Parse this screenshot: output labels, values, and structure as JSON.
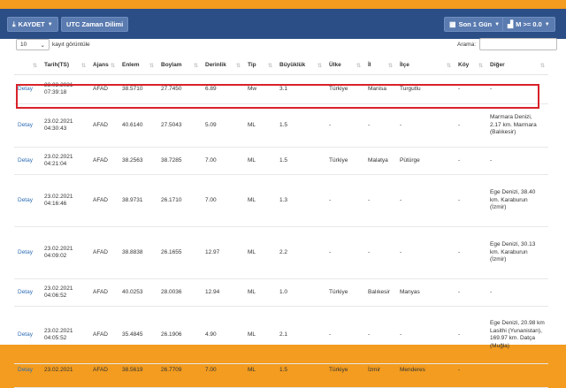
{
  "toolbar": {
    "save_label": "KAYDET",
    "utc_label": "UTC Zaman Dilimi",
    "period_label": "Son 1 Gün",
    "magnitude_label": "M >= 0.0"
  },
  "controls": {
    "page_length": "10",
    "page_length_suffix": "kayıt görüntüle",
    "search_label": "Arama:"
  },
  "table": {
    "headers": [
      "",
      "Tarih(TS)",
      "Ajans",
      "Enlem",
      "Boylam",
      "Derinlik",
      "Tip",
      "Büyüklük",
      "Ülke",
      "İl",
      "İlçe",
      "Köy",
      "Diğer"
    ],
    "rows": [
      {
        "detail": "Detay",
        "date": "23.02.2021",
        "time": "07:39:18",
        "agency": "AFAD",
        "lat": "38.5710",
        "lon": "27.7450",
        "depth": "6.89",
        "type": "Mw",
        "mag": "3.1",
        "country": "Türkiye",
        "province": "Manisa",
        "district": "Turgutlu",
        "village": "-",
        "other": "-"
      },
      {
        "detail": "Detay",
        "date": "23.02.2021",
        "time": "04:30:43",
        "agency": "AFAD",
        "lat": "40.6140",
        "lon": "27.5043",
        "depth": "5.09",
        "type": "ML",
        "mag": "1.5",
        "country": "-",
        "province": "-",
        "district": "-",
        "village": "-",
        "other": "Marmara Denizi, 2.17 km. Marmara (Balıkesir)"
      },
      {
        "detail": "Detay",
        "date": "23.02.2021",
        "time": "04:21:04",
        "agency": "AFAD",
        "lat": "38.2563",
        "lon": "38.7285",
        "depth": "7.00",
        "type": "ML",
        "mag": "1.5",
        "country": "Türkiye",
        "province": "Malatya",
        "district": "Pütürge",
        "village": "-",
        "other": "-"
      },
      {
        "detail": "Detay",
        "date": "23.02.2021",
        "time": "04:16:46",
        "agency": "AFAD",
        "lat": "38.9731",
        "lon": "26.1710",
        "depth": "7.00",
        "type": "ML",
        "mag": "1.3",
        "country": "-",
        "province": "-",
        "district": "-",
        "village": "-",
        "other": "Ege Denizi, 38.40 km. Karaburun (İzmir)"
      },
      {
        "detail": "Detay",
        "date": "23.02.2021",
        "time": "04:09:02",
        "agency": "AFAD",
        "lat": "38.8838",
        "lon": "26.1655",
        "depth": "12.97",
        "type": "ML",
        "mag": "2.2",
        "country": "-",
        "province": "-",
        "district": "-",
        "village": "-",
        "other": "Ege Denizi, 30.13 km. Karaburun (İzmir)"
      },
      {
        "detail": "Detay",
        "date": "23.02.2021",
        "time": "04:06:52",
        "agency": "AFAD",
        "lat": "40.0253",
        "lon": "28.0036",
        "depth": "12.94",
        "type": "ML",
        "mag": "1.0",
        "country": "Türkiye",
        "province": "Balıkesir",
        "district": "Manyas",
        "village": "-",
        "other": "-"
      },
      {
        "detail": "Detay",
        "date": "23.02.2021",
        "time": "04:05:52",
        "agency": "AFAD",
        "lat": "35.4845",
        "lon": "26.1906",
        "depth": "4.90",
        "type": "ML",
        "mag": "2.1",
        "country": "-",
        "province": "-",
        "district": "-",
        "village": "-",
        "other": "Ege Denizi, 20.98 km Lasithi (Yunanistan), 169.97 km. Datça (Muğla)"
      },
      {
        "detail": "Detay",
        "date": "23.02.2021",
        "time": "",
        "agency": "AFAD",
        "lat": "38.5619",
        "lon": "26.7709",
        "depth": "7.00",
        "type": "ML",
        "mag": "1.5",
        "country": "Türkiye",
        "province": "İzmir",
        "district": "Menderes",
        "village": "-",
        "other": ""
      }
    ]
  },
  "colors": {
    "page_border": "#f39c1f",
    "header_bar": "#2b4e86",
    "button": "#5a7bb0",
    "link": "#2d6db5",
    "highlight": "#d8222a"
  }
}
